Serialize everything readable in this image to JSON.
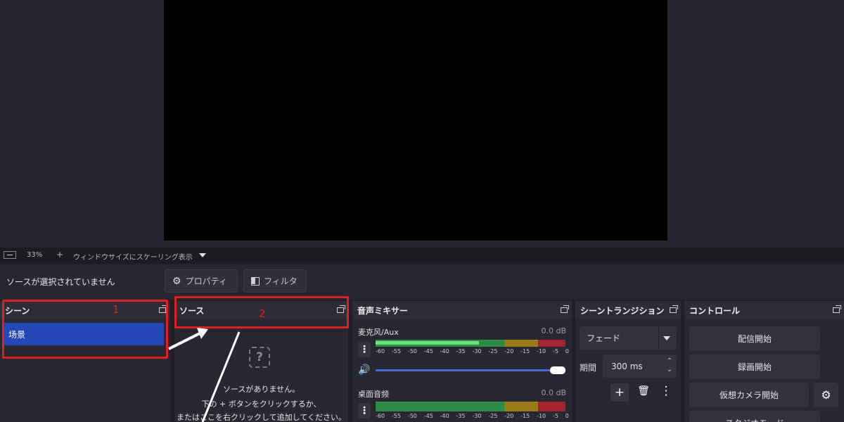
{
  "zoom_bar": {
    "zoom": "33%",
    "plus": "+",
    "scale_mode": "ウィンドウサイズにスケーリング表示"
  },
  "context_bar": {
    "no_source": "ソースが選択されていません",
    "properties": "プロパティ",
    "filters": "フィルタ"
  },
  "scenes": {
    "title": "シーン",
    "items": [
      "场景"
    ],
    "annotation": "1"
  },
  "sources": {
    "title": "ソース",
    "annotation": "2",
    "help_icon": "?",
    "empty_line1": "ソースがありません。",
    "empty_line2": "下の + ボタンをクリックするか、",
    "empty_line3": "またはここを右クリックして追加してください。"
  },
  "mixer": {
    "title": "音声ミキサー",
    "channels": [
      {
        "name": "麦克风/Aux",
        "db": "0.0 dB"
      },
      {
        "name": "桌面音频",
        "db": "0.0 dB"
      }
    ],
    "ticks": [
      "-60",
      "-55",
      "-50",
      "-45",
      "-40",
      "-35",
      "-30",
      "-25",
      "-20",
      "-15",
      "-10",
      "-5",
      "0"
    ]
  },
  "transitions": {
    "title": "シーントランジション",
    "type": "フェード",
    "duration_label": "期間",
    "duration": "300 ms"
  },
  "controls": {
    "title": "コントロール",
    "start_stream": "配信開始",
    "start_record": "録画開始",
    "virtual_cam": "仮想カメラ開始",
    "studio_mode": "スタジオモード"
  },
  "colors": {
    "scene_selected": "#2448b8",
    "annotation_red": "#e02020",
    "meter_green": "#2e8b45",
    "meter_yellow": "#9b7a18",
    "meter_red": "#a22430"
  }
}
